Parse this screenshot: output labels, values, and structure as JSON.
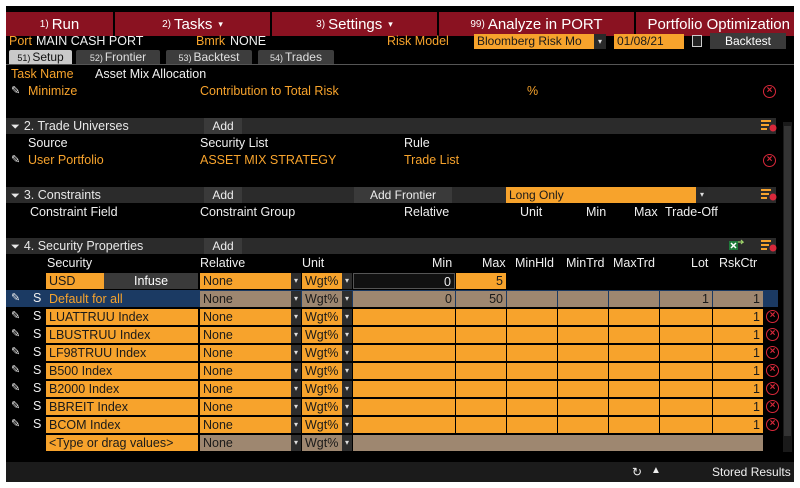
{
  "menu": [
    {
      "num": "1)",
      "label": "Run",
      "caret": ""
    },
    {
      "num": "2)",
      "label": "Tasks",
      "caret": "▾"
    },
    {
      "num": "3)",
      "label": "Settings",
      "caret": "▾"
    },
    {
      "num": "99)",
      "label": "Analyze in PORT",
      "caret": ""
    },
    {
      "num": "",
      "label": "Portfolio Optimization",
      "caret": ""
    }
  ],
  "port_row": {
    "port_label": "Port",
    "port_value": "MAIN CASH PORT",
    "bmrk_label": "Bmrk",
    "bmrk_value": "NONE",
    "risk_model_label": "Risk Model",
    "risk_model_value": "Bloomberg Risk Mo",
    "date_value": "01/08/21",
    "backtest_label": "Backtest"
  },
  "tabs": [
    {
      "num": "51)",
      "label": "Setup"
    },
    {
      "num": "52)",
      "label": "Frontier"
    },
    {
      "num": "53)",
      "label": "Backtest"
    },
    {
      "num": "54)",
      "label": "Trades"
    }
  ],
  "task": {
    "name_label": "Task Name",
    "name_value": "Asset Mix Allocation",
    "minimize_label": "Minimize",
    "minimize_value": "Contribution to Total Risk",
    "unit": "%"
  },
  "section2": {
    "title": "2. Trade Universes",
    "add_label": "Add",
    "headers": [
      "Source",
      "Security List",
      "Rule"
    ],
    "row": {
      "source": "User Portfolio",
      "security_list": "ASSET MIX STRATEGY",
      "rule": "Trade List"
    }
  },
  "section3": {
    "title": "3. Constraints",
    "add_label": "Add",
    "add_frontier_label": "Add Frontier",
    "dropdown_value": "Long Only",
    "headers": [
      "Constraint Field",
      "Constraint Group",
      "Relative",
      "Unit",
      "Min",
      "Max",
      "Trade-Off"
    ]
  },
  "section4": {
    "title": "4. Security Properties",
    "add_label": "Add",
    "headers": [
      "Security",
      "Relative",
      "Unit",
      "Min",
      "Max",
      "MinHld",
      "MinTrd",
      "MaxTrd",
      "Lot",
      "RskCtr"
    ],
    "usd_row": {
      "security": "USD",
      "infuse_label": "Infuse",
      "relative": "None",
      "unit": "Wgt%",
      "min": "0",
      "max": "5"
    },
    "default_row": {
      "flag": "S",
      "security": "Default for all",
      "relative": "None",
      "unit": "Wgt%",
      "min": "0",
      "max": "50",
      "lot": "1",
      "rskctr": "1"
    },
    "rows": [
      {
        "flag": "S",
        "security": "LUATTRUU Index",
        "relative": "None",
        "unit": "Wgt%",
        "rskctr": "1"
      },
      {
        "flag": "S",
        "security": "LBUSTRUU Index",
        "relative": "None",
        "unit": "Wgt%",
        "rskctr": "1"
      },
      {
        "flag": "S",
        "security": "LF98TRUU Index",
        "relative": "None",
        "unit": "Wgt%",
        "rskctr": "1"
      },
      {
        "flag": "S",
        "security": "B500 Index",
        "relative": "None",
        "unit": "Wgt%",
        "rskctr": "1"
      },
      {
        "flag": "S",
        "security": "B2000 Index",
        "relative": "None",
        "unit": "Wgt%",
        "rskctr": "1"
      },
      {
        "flag": "S",
        "security": "BBREIT Index",
        "relative": "None",
        "unit": "Wgt%",
        "rskctr": "1"
      },
      {
        "flag": "S",
        "security": "BCOM Index",
        "relative": "None",
        "unit": "Wgt%",
        "rskctr": "1"
      }
    ],
    "placeholder_row": {
      "security": "<Type or drag values>",
      "relative": "None",
      "unit": "Wgt%"
    }
  },
  "status": {
    "stored_label": "Stored Results"
  },
  "colors": {
    "menu_bg": "#8a1221",
    "accent_orange": "#f7a32c",
    "tan": "#9e8770",
    "delete_red": "#d9283a",
    "selection_blue": "#1b3a63"
  }
}
